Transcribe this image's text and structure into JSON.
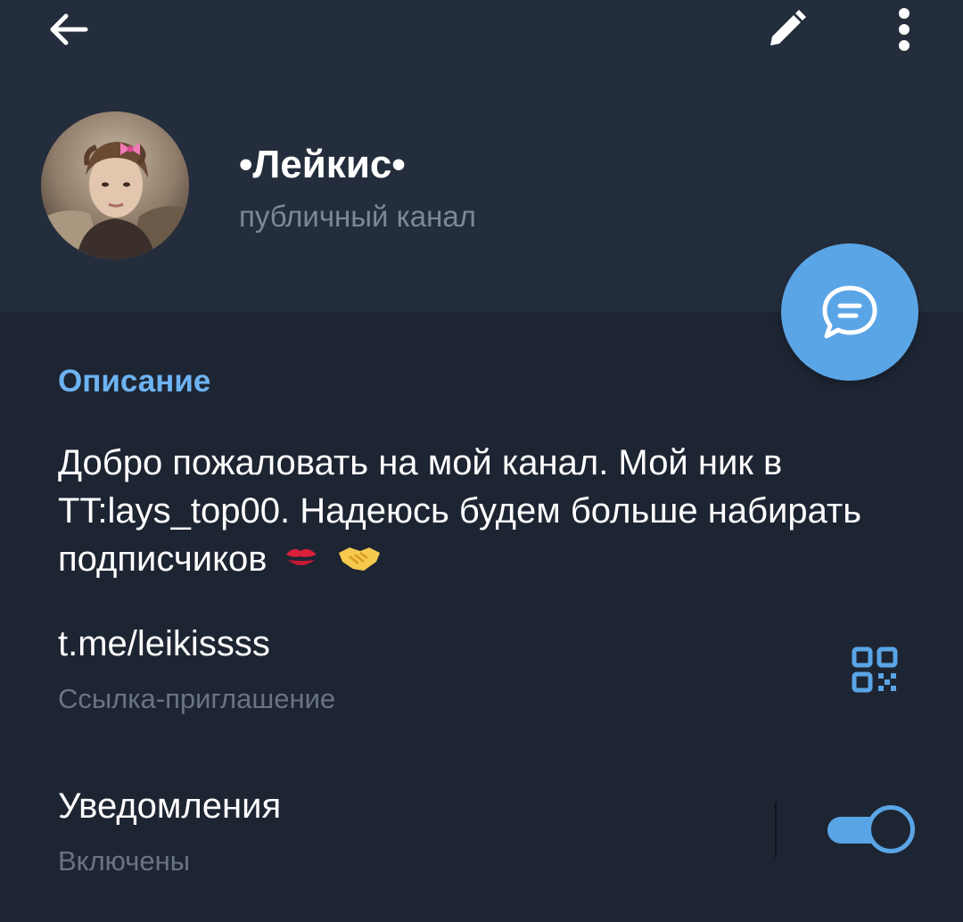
{
  "toolbar": {
    "back_icon": "arrow-left-icon",
    "edit_icon": "pencil-icon",
    "more_icon": "more-vertical-icon"
  },
  "channel": {
    "title": "•Лейкис•",
    "subtitle": "публичный канал"
  },
  "fab": {
    "icon": "chat-bubble-icon"
  },
  "description": {
    "heading": "Описание",
    "text": "Добро пожаловать на мой канал. Мой ник в TT:lays_top00. Надеюсь будем больше набирать подписчиков",
    "emojis": [
      "kiss-mark-emoji",
      "handshake-emoji"
    ]
  },
  "link": {
    "url": "t.me/leikissss",
    "label": "Ссылка-приглашение",
    "icon": "qr-code-icon"
  },
  "notifications": {
    "label": "Уведомления",
    "status": "Включены",
    "enabled": true
  },
  "colors": {
    "background": "#1d2533",
    "header": "#242d3c",
    "accent": "#5aa5e6",
    "section_title": "#6db3f2",
    "secondary_text": "#6a7480"
  }
}
